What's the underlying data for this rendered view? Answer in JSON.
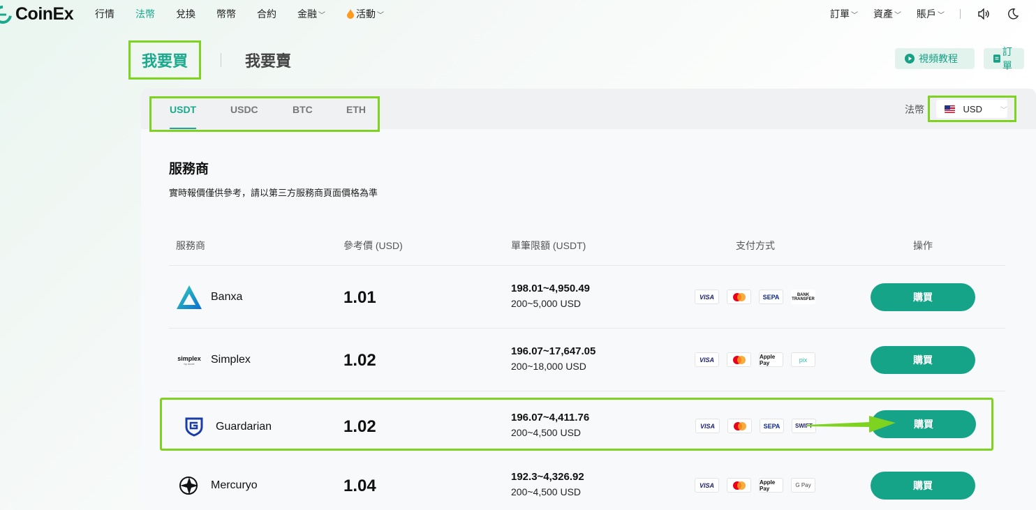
{
  "brand": {
    "name": "CoinEx",
    "accent": "#1aa98c",
    "highlight": "#7ed321"
  },
  "nav": {
    "items": [
      {
        "label": "行情",
        "active": false,
        "dropdown": false
      },
      {
        "label": "法幣",
        "active": true,
        "dropdown": false
      },
      {
        "label": "兌換",
        "active": false,
        "dropdown": false
      },
      {
        "label": "幣幣",
        "active": false,
        "dropdown": false
      },
      {
        "label": "合約",
        "active": false,
        "dropdown": false
      },
      {
        "label": "金融",
        "active": false,
        "dropdown": true
      },
      {
        "label": "活動",
        "active": false,
        "dropdown": true,
        "icon": "fire-icon"
      }
    ],
    "right": [
      {
        "label": "訂單"
      },
      {
        "label": "資產"
      },
      {
        "label": "賬戶"
      }
    ],
    "right_icons": [
      "speaker-icon",
      "moon-icon"
    ]
  },
  "mode_tabs": {
    "buy": "我要買",
    "sell": "我要賣"
  },
  "top_buttons": {
    "video": "視頻教程",
    "orders": "訂單"
  },
  "coin_tabs": [
    "USDT",
    "USDC",
    "BTC",
    "ETH"
  ],
  "fiat": {
    "label": "法幣",
    "selected": "USD"
  },
  "section": {
    "title": "服務商",
    "subtitle": "實時報價僅供參考，請以第三方服務商頁面價格為準"
  },
  "table": {
    "headers": {
      "provider": "服務商",
      "price": "參考價 (USD)",
      "limit": "單筆限額 (USDT)",
      "payment": "支付方式",
      "action": "操作"
    },
    "rows": [
      {
        "name": "Banxa",
        "price": "1.01",
        "limit": "198.01~4,950.49",
        "limit_fiat": "200~5,000 USD",
        "payments": [
          "VISA",
          "mastercard",
          "SEPA",
          "BANK TRANSFER"
        ],
        "button": "購買"
      },
      {
        "name": "Simplex",
        "price": "1.02",
        "limit": "196.07~17,647.05",
        "limit_fiat": "200~18,000 USD",
        "payments": [
          "VISA",
          "mastercard",
          "Apple Pay",
          "pix"
        ],
        "button": "購買"
      },
      {
        "name": "Guardarian",
        "price": "1.02",
        "limit": "196.07~4,411.76",
        "limit_fiat": "200~4,500 USD",
        "payments": [
          "VISA",
          "mastercard",
          "SEPA",
          "SWIFT"
        ],
        "button": "購買"
      },
      {
        "name": "Mercuryo",
        "price": "1.04",
        "limit": "192.3~4,326.92",
        "limit_fiat": "200~4,500 USD",
        "payments": [
          "VISA",
          "mastercard",
          "Apple Pay",
          "G Pay"
        ],
        "button": "購買"
      }
    ]
  },
  "provider_logo_text": {
    "simplex": "simplex",
    "simplex_small": "by nuvei"
  }
}
